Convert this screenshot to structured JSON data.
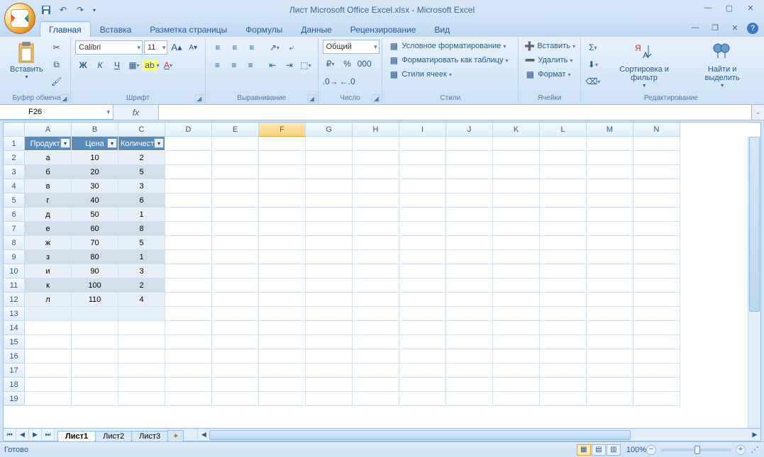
{
  "title": "Лист Microsoft Office Excel.xlsx - Microsoft Excel",
  "tabs": [
    "Главная",
    "Вставка",
    "Разметка страницы",
    "Формулы",
    "Данные",
    "Рецензирование",
    "Вид"
  ],
  "activeTab": 0,
  "ribbon": {
    "clipboard": {
      "label": "Буфер обмена",
      "paste": "Вставить"
    },
    "font": {
      "label": "Шрифт",
      "name": "Calibri",
      "size": "11",
      "bold": "Ж",
      "italic": "К",
      "underline": "Ч"
    },
    "align": {
      "label": "Выравнивание"
    },
    "number": {
      "label": "Число",
      "format": "Общий"
    },
    "styles": {
      "label": "Стили",
      "conditional": "Условное форматирование",
      "table": "Форматировать как таблицу",
      "cell": "Стили ячеек"
    },
    "cells": {
      "label": "Ячейки",
      "insert": "Вставить",
      "delete": "Удалить",
      "format": "Формат"
    },
    "editing": {
      "label": "Редактирование",
      "sort": "Сортировка и фильтр",
      "find": "Найти и выделить"
    }
  },
  "namebox": "F26",
  "fx": "fx",
  "columns": [
    "A",
    "B",
    "C",
    "D",
    "E",
    "F",
    "G",
    "H",
    "I",
    "J",
    "K",
    "L",
    "M",
    "N"
  ],
  "selectedCol": "F",
  "rows": 19,
  "table": {
    "headers": [
      "Продукты",
      "Цена",
      "Количество"
    ],
    "data": [
      [
        "а",
        "10",
        "2"
      ],
      [
        "б",
        "20",
        "5"
      ],
      [
        "в",
        "30",
        "3"
      ],
      [
        "г",
        "40",
        "6"
      ],
      [
        "д",
        "50",
        "1"
      ],
      [
        "е",
        "60",
        "8"
      ],
      [
        "ж",
        "70",
        "5"
      ],
      [
        "з",
        "80",
        "1"
      ],
      [
        "и",
        "90",
        "3"
      ],
      [
        "к",
        "100",
        "2"
      ],
      [
        "л",
        "110",
        "4"
      ]
    ]
  },
  "sheets": [
    "Лист1",
    "Лист2",
    "Лист3"
  ],
  "activeSheet": 0,
  "status": "Готово",
  "zoom": "100%"
}
